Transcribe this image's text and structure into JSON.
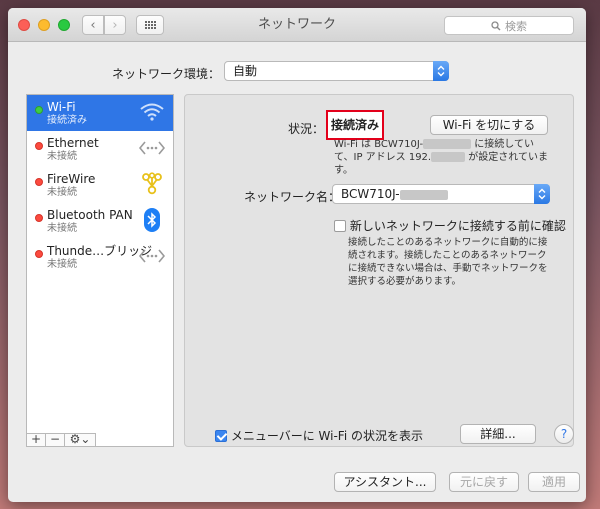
{
  "window": {
    "title": "ネットワーク",
    "search_placeholder": "検索"
  },
  "location": {
    "label": "ネットワーク環境：",
    "value": "自動"
  },
  "services": [
    {
      "name": "Wi-Fi",
      "status": "接続済み",
      "dot": "green",
      "icon": "wifi-icon",
      "selected": true
    },
    {
      "name": "Ethernet",
      "status": "未接続",
      "dot": "red",
      "icon": "ethernet-icon",
      "selected": false
    },
    {
      "name": "FireWire",
      "status": "未接続",
      "dot": "red",
      "icon": "firewire-icon",
      "selected": false
    },
    {
      "name": "Bluetooth PAN",
      "status": "未接続",
      "dot": "red",
      "icon": "bluetooth-icon",
      "selected": false
    },
    {
      "name": "Thunde…ブリッジ",
      "status": "未接続",
      "dot": "red",
      "icon": "thunderbolt-bridge-icon",
      "selected": false
    }
  ],
  "sidebar_toolbar": {
    "add": "+",
    "remove": "−",
    "gear": "⚙︎⌄"
  },
  "detail": {
    "status_label": "状況：",
    "status_value": "接続済み",
    "wifi_off_button": "Wi-Fi を切にする",
    "status_desc_a": "Wi-Fi は BCW710J-",
    "status_desc_b": " に接続していて、IP アドレス 192.",
    "status_desc_c": " が設定されています。",
    "network_name_label": "ネットワーク名：",
    "network_name_value": "BCW710J-",
    "ask_join_label": "新しいネットワークに接続する前に確認",
    "ask_join_checked": false,
    "ask_join_desc": "接続したことのあるネットワークに自動的に接続されます。接続したことのあるネットワークに接続できない場合は、手動でネットワークを選択する必要があります。",
    "menubar_label": "メニューバーに Wi-Fi の状況を表示",
    "menubar_checked": true,
    "advanced_button": "詳細...",
    "help_button": "?"
  },
  "footer": {
    "assistant_button": "アシスタント...",
    "revert_button": "元に戻す",
    "apply_button": "適用"
  },
  "colors": {
    "selection": "#2f76e6",
    "highlight_box": "#e3001b",
    "connected": "#3fce45",
    "disconnected": "#fc4a3f"
  }
}
